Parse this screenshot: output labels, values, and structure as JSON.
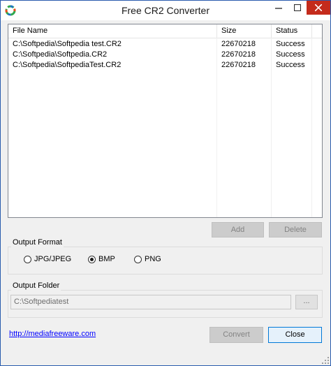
{
  "window": {
    "title": "Free CR2 Converter",
    "colors": {
      "close": "#c42b1c",
      "border": "#2a5cae",
      "link": "#0000ff"
    }
  },
  "list": {
    "columns": [
      "File Name",
      "Size",
      "Status"
    ],
    "rows": [
      [
        "C:\\Softpedia\\Softpedia test.CR2",
        "22670218",
        "Success"
      ],
      [
        "C:\\Softpedia\\Softpedia.CR2",
        "22670218",
        "Success"
      ],
      [
        "C:\\Softpedia\\SoftpediaTest.CR2",
        "22670218",
        "Success"
      ]
    ]
  },
  "list_buttons": {
    "add": "Add",
    "delete": "Delete"
  },
  "output_format": {
    "label": "Output Format",
    "options": [
      "JPG/JPEG",
      "BMP",
      "PNG"
    ],
    "selected": "BMP"
  },
  "output_folder": {
    "label": "Output Folder",
    "value": "C:\\Softpediatest",
    "browse": "..."
  },
  "footer": {
    "link": "http://mediafreeware.com",
    "convert": "Convert",
    "close": "Close"
  }
}
